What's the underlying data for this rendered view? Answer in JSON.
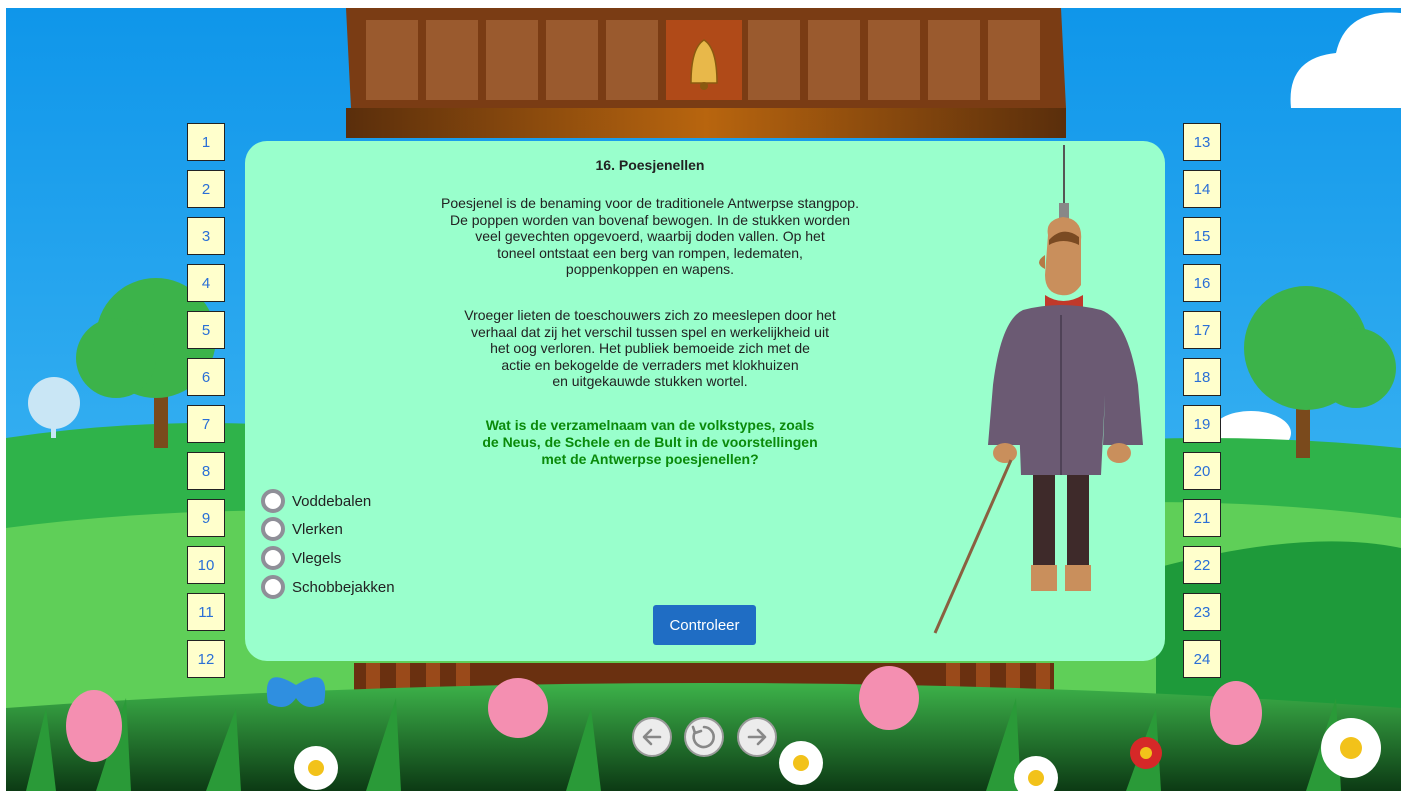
{
  "quiz": {
    "title": "16. Poesjenellen",
    "paragraph1": "Poesjenel is de benaming voor de traditionele Antwerpse stangpop.\nDe poppen worden van bovenaf bewogen. In de stukken worden\nveel gevechten opgevoerd, waarbij doden vallen. Op het\ntoneel ontstaat een berg van rompen, ledematen,\npoppenkoppen en wapens.",
    "paragraph2": "Vroeger lieten de toeschouwers zich zo meeslepen door het\nverhaal dat zij het verschil tussen spel en werkelijkheid uit\nhet oog verloren. Het publiek bemoeide zich met de\nactie en bekogelde de verraders met klokhuizen\nen uitgekauwde stukken wortel.",
    "question": "Wat is de verzamelnaam van de volkstypes, zoals\nde Neus, de Schele en de Bult in de voorstellingen\nmet de Antwerpse poesjenellen?",
    "options": [
      "Voddebalen",
      "Vlerken",
      "Vlegels",
      "Schobbejakken"
    ],
    "check_label": "Controleer"
  },
  "left_numbers": [
    "1",
    "2",
    "3",
    "4",
    "5",
    "6",
    "7",
    "8",
    "9",
    "10",
    "11",
    "12"
  ],
  "right_numbers": [
    "13",
    "14",
    "15",
    "16",
    "17",
    "18",
    "19",
    "20",
    "21",
    "22",
    "23",
    "24"
  ],
  "nav": {
    "icons": [
      "arrow-left-icon",
      "reload-icon",
      "arrow-right-icon"
    ]
  },
  "colors": {
    "panel": "#99ffcc",
    "question": "#0a8a0a",
    "button": "#1f6dc4",
    "number_box": "#ffffcc",
    "number_text": "#2a6fd6",
    "sky": "#1ea3f0"
  }
}
